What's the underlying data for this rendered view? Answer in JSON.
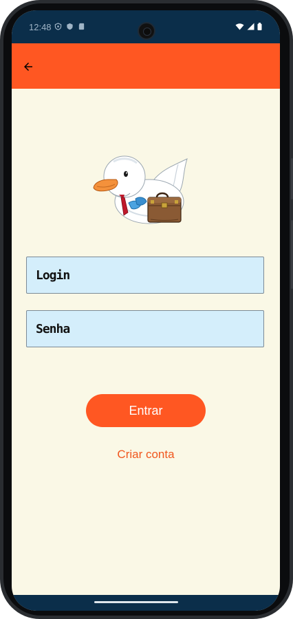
{
  "status_bar": {
    "time": "12:48"
  },
  "app_bar": {
    "back_icon": "arrow-back-icon"
  },
  "login": {
    "username_placeholder": "Login",
    "password_placeholder": "Senha",
    "submit_label": "Entrar",
    "create_account_label": "Criar conta"
  },
  "colors": {
    "accent": "#ff5722",
    "background": "#faf8e6",
    "field_background": "#d4eefb",
    "status_bar": "#0b2e4a"
  }
}
